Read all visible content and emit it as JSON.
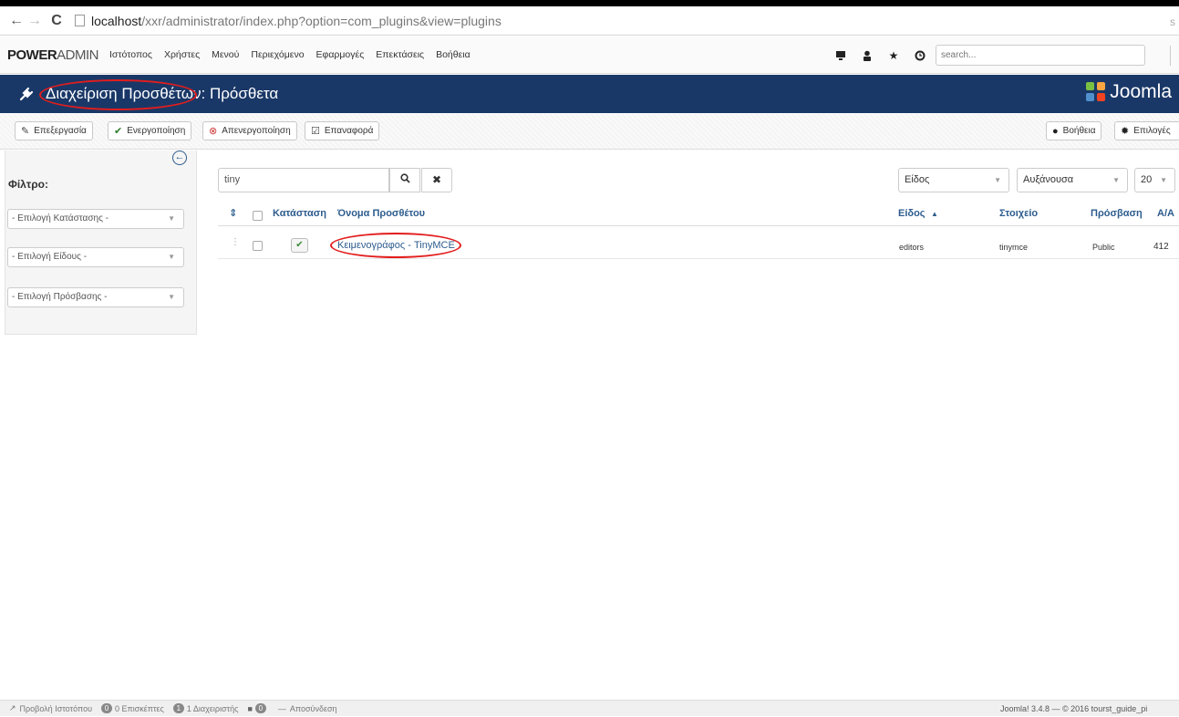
{
  "browser": {
    "url_host": "localhost",
    "url_path": "/xxr/administrator/index.php?option=com_plugins&view=plugins",
    "right_fragment": "s"
  },
  "menubar": {
    "brand_bold": "POWER",
    "brand_rest": "ADMIN",
    "items": [
      "Ιστότοπος",
      "Χρήστες",
      "Μενού",
      "Περιεχόμενο",
      "Εφαρμογές",
      "Επεκτάσεις",
      "Βοήθεια"
    ],
    "search_placeholder": "search..."
  },
  "header": {
    "title": "Διαχείριση Προσθέτων: Πρόσθετα",
    "brand": "Joomla"
  },
  "toolbar": {
    "edit": "Επεξεργασία",
    "enable": "Ενεργοποίηση",
    "disable": "Απενεργοποίηση",
    "checkin": "Επαναφορά",
    "help": "Βοήθεια",
    "options": "Επιλογές"
  },
  "sidebar": {
    "filter_label": "Φίλτρο:",
    "state_select": "- Επιλογή Κατάστασης -",
    "type_select": "- Επιλογή Είδους -",
    "access_select": "- Επιλογή Πρόσβασης -"
  },
  "search": {
    "value": "tiny"
  },
  "sort": {
    "field": "Είδος",
    "direction": "Αυξάνουσα",
    "limit": "20"
  },
  "table": {
    "headers": {
      "status": "Κατάσταση",
      "name": "Όνομα Προσθέτου",
      "type": "Είδος",
      "type_sort_icon": "▲",
      "element": "Στοιχείο",
      "access": "Πρόσβαση",
      "id": "Α/Α"
    },
    "rows": [
      {
        "name": "Κειμενογράφος - TinyMCE",
        "type": "editors",
        "element": "tinymce",
        "access": "Public",
        "id": "412"
      }
    ]
  },
  "statusbar": {
    "view_site": "Προβολή Ιστοτόπου",
    "visitors_count": "0",
    "visitors": "0 Επισκέπτες",
    "admins_count": "1",
    "admins": "1 Διαχειριστής",
    "messages_count": "0",
    "logout": "Αποσύνδεση",
    "right_text": "Joomla! 3.4.8 — © 2016 tourst_guide_pi"
  },
  "colors": {
    "header_bg": "#1a3867",
    "link": "#2d5c8e",
    "annotation": "#e31d1d"
  }
}
